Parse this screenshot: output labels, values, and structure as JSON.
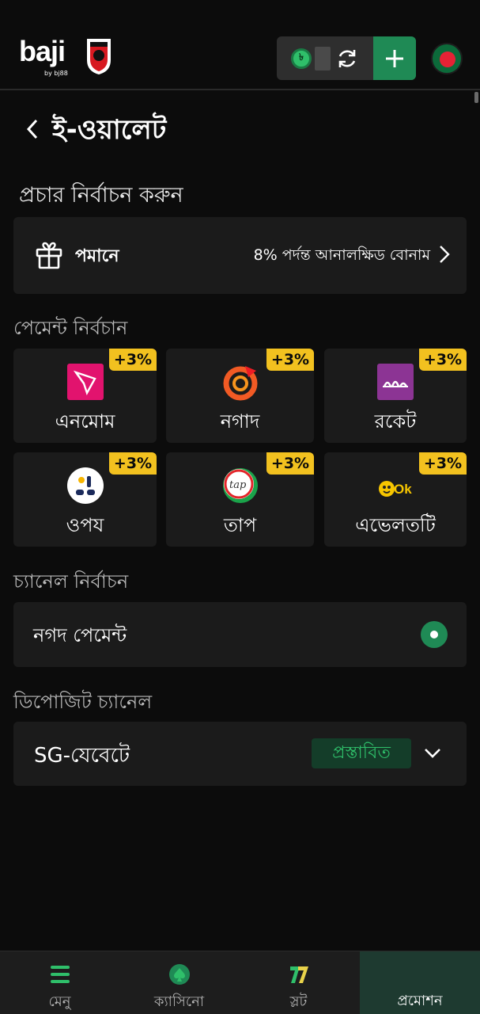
{
  "header": {
    "logo_text": "baji",
    "logo_sub": "by bj88",
    "currency_symbol": "৳",
    "add_label": "+",
    "colors": {
      "accent": "#1f8a55",
      "background": "#0c0c0c"
    }
  },
  "page": {
    "back_icon": "chevron-left-icon",
    "title": "ই-ওয়ালেট"
  },
  "promotion": {
    "section_title": "প্রচার নির্বাচন করুন",
    "icon": "gift-icon",
    "name": "পমানে",
    "description": "8% পর্দন্ত আনালক্ষিড বোনাম"
  },
  "payment": {
    "section_title": "পেমেন্ট নির্বচান",
    "badge_color": "#f2c11f",
    "methods": [
      {
        "name": "এনমোম",
        "badge": "+3%",
        "icon": "bkash-logo-icon"
      },
      {
        "name": "নগাদ",
        "badge": "+3%",
        "icon": "nagad-logo-icon"
      },
      {
        "name": "রকেট",
        "badge": "+3%",
        "icon": "rocket-logo-icon"
      },
      {
        "name": "ওপয",
        "badge": "+3%",
        "icon": "upay-logo-icon"
      },
      {
        "name": "তাপ",
        "badge": "+3%",
        "icon": "tap-logo-icon"
      },
      {
        "name": "এভেলতটি",
        "badge": "+3%",
        "icon": "ok-wallet-logo-icon"
      }
    ]
  },
  "channel": {
    "section_title": "চ্যানেল নির্বাচন",
    "selected": "নগদ পেমেন্ট"
  },
  "deposit_channel": {
    "section_title": "ডিপোজিট চ্যানেল",
    "selected": "SG-যেবেটে",
    "tag": "প্রস্তাবিত"
  },
  "bottom_nav": [
    {
      "label": "মেনু",
      "icon": "menu-icon"
    },
    {
      "label": "ক্যাসিনো",
      "icon": "casino-spade-icon"
    },
    {
      "label": "স্লট",
      "icon": "slot-777-icon"
    },
    {
      "label": "প্রমোশন",
      "icon": "promotion-icon",
      "active": true
    }
  ]
}
